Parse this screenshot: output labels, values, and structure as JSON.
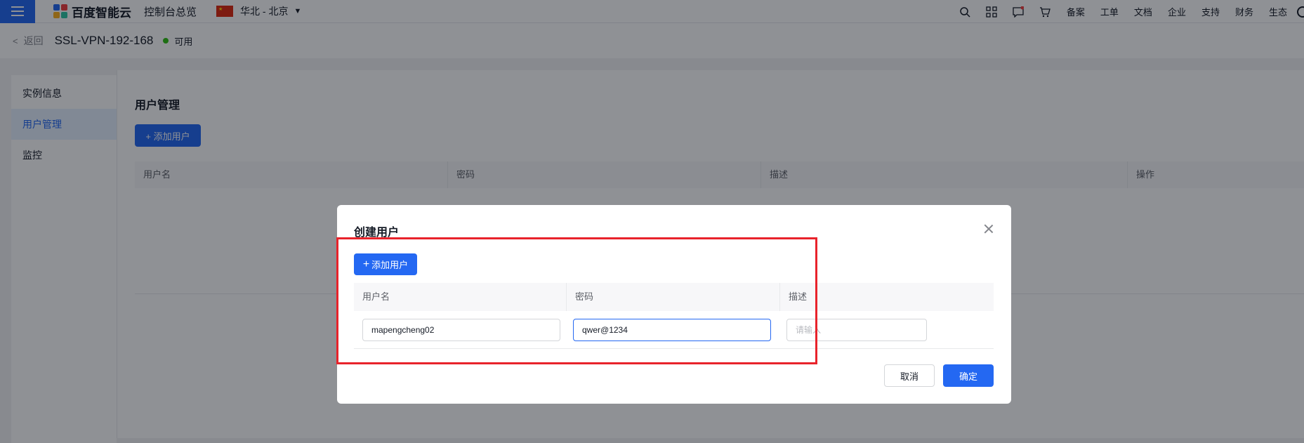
{
  "topnav": {
    "logo_text": "百度智能云",
    "console_label": "控制台总览",
    "region_label": "华北 - 北京",
    "links": [
      "备案",
      "工单",
      "文档",
      "企业",
      "支持",
      "财务",
      "生态"
    ]
  },
  "subheader": {
    "back_label": "返回",
    "instance_title": "SSL-VPN-192-168",
    "status": "可用"
  },
  "sidebar": {
    "items": [
      {
        "label": "实例信息"
      },
      {
        "label": "用户管理"
      },
      {
        "label": "监控"
      }
    ],
    "active_index": 1
  },
  "main": {
    "title": "用户管理",
    "add_button": "+ 添加用户",
    "columns": [
      "用户名",
      "密码",
      "描述",
      "操作"
    ]
  },
  "modal": {
    "title": "创建用户",
    "add_button": "添加用户",
    "columns": [
      "用户名",
      "密码",
      "描述"
    ],
    "row": {
      "username": "mapengcheng02",
      "password": "qwer@1234",
      "description_placeholder": "请输入"
    },
    "cancel_label": "取消",
    "ok_label": "确定"
  },
  "colors": {
    "primary": "#2468f2",
    "status_ok": "#30bf13",
    "highlight": "#e8232b"
  }
}
